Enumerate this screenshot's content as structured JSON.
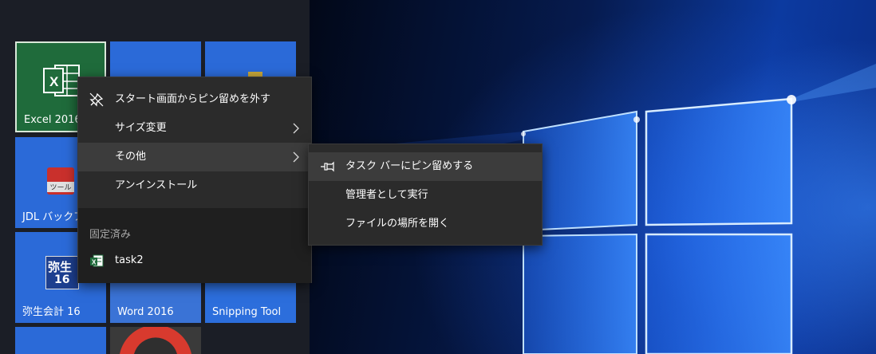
{
  "tiles": {
    "excel": {
      "label": "Excel 2016",
      "icon": "excel-icon"
    },
    "jdl": {
      "label": "JDL バックア",
      "icon_text": "ツール",
      "icon": "toolbox-icon"
    },
    "yayoi": {
      "label": "弥生会計 16",
      "icon_text_top": "弥生",
      "icon_text_bottom": "16",
      "icon": "yayoi-icon"
    },
    "word": {
      "label": "Word 2016"
    },
    "snipping": {
      "label": "Snipping Tool"
    }
  },
  "context_menu": {
    "items": [
      {
        "label": "スタート画面からピン留めを外す",
        "icon": "unpin-icon"
      },
      {
        "label": "サイズ変更",
        "has_submenu": true
      },
      {
        "label": "その他",
        "has_submenu": true,
        "highlighted": true
      },
      {
        "label": "アンインストール"
      }
    ],
    "section_header": "固定済み",
    "pinned": [
      {
        "label": "task2",
        "icon": "excel-file-icon"
      }
    ]
  },
  "submenu": {
    "items": [
      {
        "label": "タスク バーにピン留めする",
        "icon": "pin-icon",
        "highlighted": true
      },
      {
        "label": "管理者として実行"
      },
      {
        "label": "ファイルの場所を開く"
      }
    ]
  },
  "colors": {
    "menu_bg": "#2b2b2b",
    "menu_highlight": "#3c3c3c",
    "tile_blue": "#2b6ad8",
    "excel_green": "#1f6b3b"
  }
}
